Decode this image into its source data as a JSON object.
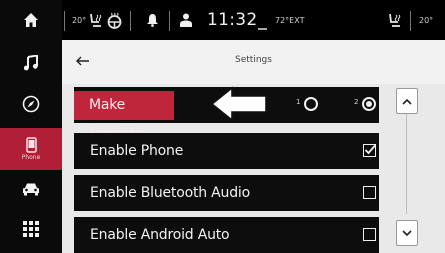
{
  "rail": {
    "items": [
      {
        "name": "home-icon"
      },
      {
        "name": "music-icon"
      },
      {
        "name": "navigation-compass-icon"
      },
      {
        "name": "phone-icon",
        "label": "Phone",
        "active": true
      },
      {
        "name": "car-icon"
      },
      {
        "name": "apps-grid-icon"
      }
    ]
  },
  "status": {
    "left_temp": "20°",
    "clock": "11:32",
    "ext_temp": "72°EXT",
    "right_temp": "20°"
  },
  "settings": {
    "title": "Settings",
    "rows": [
      {
        "label": "Make Favorite",
        "option1": "1",
        "option2": "2",
        "selected": 2
      },
      {
        "label": "Enable Phone",
        "checked": true
      },
      {
        "label": "Enable Bluetooth Audio",
        "checked": false
      },
      {
        "label": "Enable Android Auto",
        "checked": false
      }
    ]
  },
  "colors": {
    "accent_red": "#b01f36",
    "panel_bg": "#e9e9e9",
    "row_bg": "#0d0d0d"
  }
}
